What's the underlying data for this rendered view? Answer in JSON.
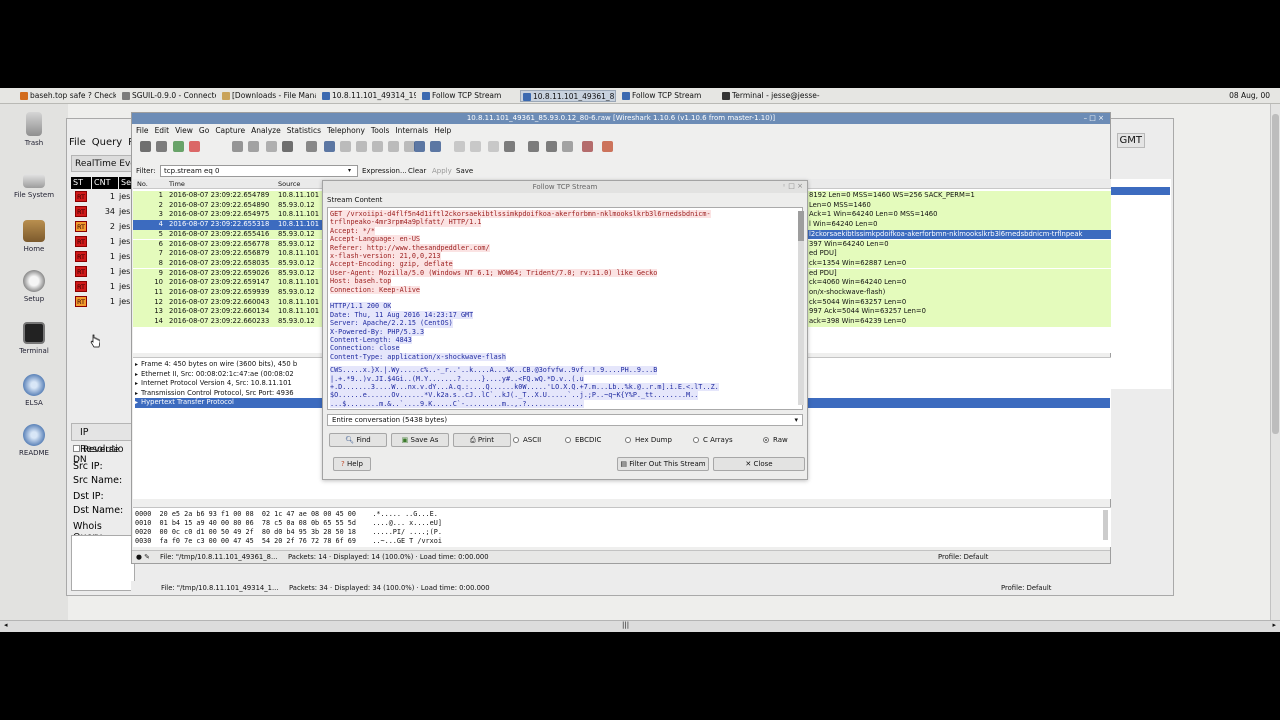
{
  "taskbar": {
    "tasks": [
      {
        "label": "baseh.top safe ? Check ..."
      },
      {
        "label": "SGUIL-0.9.0 - Connecte..."
      },
      {
        "label": "[Downloads - File Mana..."
      },
      {
        "label": "10.8.11.101_49314_198..."
      },
      {
        "label": "Follow TCP Stream"
      },
      {
        "label": "10.8.11.101_49361_85..."
      },
      {
        "label": "Follow TCP Stream"
      },
      {
        "label": "Terminal - jesse@jesse-..."
      }
    ],
    "clock": "08 Aug, 00"
  },
  "desktop": {
    "icons": [
      {
        "label": "Trash"
      },
      {
        "label": "File System"
      },
      {
        "label": "Home"
      },
      {
        "label": "Setup"
      },
      {
        "label": "Terminal"
      },
      {
        "label": "ELSA"
      },
      {
        "label": "README"
      }
    ]
  },
  "sguil": {
    "menu": [
      "File",
      "Query",
      "Re"
    ],
    "tab": "RealTime Eve",
    "gmt": "GMT",
    "headers": [
      "ST",
      "CNT",
      "Se"
    ],
    "rows": [
      {
        "st": "RT",
        "cnt": "1",
        "name": "jes"
      },
      {
        "st": "RT",
        "cnt": "34",
        "name": "jes"
      },
      {
        "st": "RT",
        "cnt": "2",
        "name": "jes"
      },
      {
        "st": "RT",
        "cnt": "1",
        "name": "jes"
      },
      {
        "st": "RT",
        "cnt": "1",
        "name": "jes"
      },
      {
        "st": "RT",
        "cnt": "1",
        "name": "jes"
      },
      {
        "st": "RT",
        "cnt": "1",
        "name": "jes"
      },
      {
        "st": "RT",
        "cnt": "1",
        "name": "jes"
      }
    ],
    "ip_panel": {
      "title": "IP Resolutio",
      "reverse": "Reverse DN",
      "src_ip": "Src IP:",
      "src_name": "Src Name:",
      "dst_ip": "Dst IP:",
      "dst_name": "Dst Name:",
      "whois": "Whois Query:"
    },
    "colors": {
      "rt_red": "#d01a1a",
      "rt_orange": "#f29a2e"
    }
  },
  "wireshark": {
    "title": "10.8.11.101_49361_85.93.0.12_80-6.raw  [Wireshark 1.10.6 (v1.10.6 from master-1.10)]",
    "menu": [
      "File",
      "Edit",
      "View",
      "Go",
      "Capture",
      "Analyze",
      "Statistics",
      "Telephony",
      "Tools",
      "Internals",
      "Help"
    ],
    "filter": {
      "label": "Filter:",
      "value": "tcp.stream eq 0",
      "expression": "Expression...",
      "clear": "Clear",
      "apply": "Apply",
      "save": "Save"
    },
    "columns": [
      "No.",
      "Time",
      "Source"
    ],
    "packets": [
      {
        "no": "1",
        "time": "2016-08-07 23:09:22.654789",
        "src": "10.8.11.101"
      },
      {
        "no": "2",
        "time": "2016-08-07 23:09:22.654890",
        "src": "85.93.0.12"
      },
      {
        "no": "3",
        "time": "2016-08-07 23:09:22.654975",
        "src": "10.8.11.101"
      },
      {
        "no": "4",
        "time": "2016-08-07 23:09:22.655318",
        "src": "10.8.11.101"
      },
      {
        "no": "5",
        "time": "2016-08-07 23:09:22.655416",
        "src": "85.93.0.12"
      },
      {
        "no": "6",
        "time": "2016-08-07 23:09:22.656778",
        "src": "85.93.0.12"
      },
      {
        "no": "7",
        "time": "2016-08-07 23:09:22.656879",
        "src": "10.8.11.101"
      },
      {
        "no": "8",
        "time": "2016-08-07 23:09:22.658035",
        "src": "85.93.0.12"
      },
      {
        "no": "9",
        "time": "2016-08-07 23:09:22.659026",
        "src": "85.93.0.12"
      },
      {
        "no": "10",
        "time": "2016-08-07 23:09:22.659147",
        "src": "10.8.11.101"
      },
      {
        "no": "11",
        "time": "2016-08-07 23:09:22.659939",
        "src": "85.93.0.12"
      },
      {
        "no": "12",
        "time": "2016-08-07 23:09:22.660043",
        "src": "10.8.11.101"
      },
      {
        "no": "13",
        "time": "2016-08-07 23:09:22.660134",
        "src": "10.8.11.101"
      },
      {
        "no": "14",
        "time": "2016-08-07 23:09:22.660233",
        "src": "85.93.0.12"
      }
    ],
    "info_tail": [
      "8192 Len=0 MSS=1460 WS=256 SACK_PERM=1",
      "Len=0 MSS=1460",
      "Ack=1 Win=64240 Len=0 MSS=1460",
      "l Win=64240 Len=0",
      "l2ckorsaekibtlssimkpdoifkoa-akerforbmn-nklmookslkrb3l6rnedsbdnicm-trflnpeak",
      "397 Win=64240 Len=0",
      "ed PDU]",
      "ck=1354 Win=62887 Len=0",
      "ed PDU]",
      "ck=4060 Win=64240 Len=0",
      "on/x-shockwave-flash)",
      "ck=5044 Win=63257 Len=0",
      "997 Ack=5044 Win=63257 Len=0",
      "ack=398 Win=64239 Len=0"
    ],
    "details": [
      "Frame 4: 450 bytes on wire (3600 bits), 450 b",
      "Ethernet II, Src: 00:08:02:1c:47:ae (00:08:02",
      "Internet Protocol Version 4, Src: 10.8.11.101",
      "Transmission Control Protocol, Src Port: 4936",
      "Hypertext Transfer Protocol"
    ],
    "hex": [
      "0000  20 e5 2a b6 93 f1 00 08  02 1c 47 ae 08 00 45 00    .*..... ..G...E.",
      "0010  01 b4 15 a9 40 00 80 06  78 c5 0a 08 0b 65 55 5d    ....@... x....eU]",
      "0020  00 0c c0 d1 00 50 49 2f  80 d0 b4 95 3b 28 50 18    .....PI/ ....;(P.",
      "0030  fa f0 7e c3 00 00 47 45  54 20 2f 76 72 78 6f 69    ..~...GE T /vrxoi"
    ],
    "status": {
      "file": "File: \"/tmp/10.8.11.101_49361_8...",
      "packets": "Packets: 14 · Displayed: 14 (100.0%) · Load time: 0:00.000",
      "profile": "Profile: Default"
    },
    "colors": {
      "row_green": "#e4fbbc",
      "selection": "#3c6bbf"
    }
  },
  "background_status": {
    "file": "File: \"/tmp/10.8.11.101_49314_1...",
    "packets": "Packets: 34 · Displayed: 34 (100.0%) · Load time: 0:00.000",
    "profile": "Profile: Default"
  },
  "follow_stream": {
    "title": "Follow TCP Stream",
    "legend": "Stream Content",
    "client_lines": [
      "GET /vrxoiipi-d4flf5n4d1iftl2ckorsaekibtlssimkpdoifkoa-akerforbmn-nklmookslkrb3l6rnedsbdnicm-",
      "trflnpeako-4mr3rpm4a9plfatt/ HTTP/1.1",
      "Accept: */*",
      "Accept-Language: en-US",
      "Referer: http://www.thesandpeddler.com/",
      "x-flash-version: 21,0,0,213",
      "Accept-Encoding: gzip, deflate",
      "User-Agent: Mozilla/5.0 (Windows NT 6.1; WOW64; Trident/7.0; rv:11.0) like Gecko",
      "Host: baseh.top",
      "Connection: Keep-Alive"
    ],
    "server_lines": [
      "HTTP/1.1 200 OK",
      "Date: Thu, 11 Aug 2016 14:23:17 GMT",
      "Server: Apache/2.2.15 (CentOS)",
      "X-Powered-By: PHP/5.3.3",
      "Content-Length: 4843",
      "Connection: close",
      "Content-Type: application/x-shockwave-flash"
    ],
    "binary_lines": [
      "CWS.....x.}X.|.Wy.....c%..-_r..'..k....A...%K..CB.@3ofvfw..9vf..!.9....PH..9...B",
      "|.+.*9..)v.JI.$4Gi..(M.Y.......?.....}....y#..<FQ.wQ.*D.v..(.u",
      "+.D.......3....W...nx.v.dY...A.q.:....Q......k0W.....'LO.X.Q.+7.m...Lb..%k.@..r.m].i.E.<.lT..Z.",
      "$O......e......Ov......*V.k2a.s..cJ..lC`..kJ(._T..X.U.....`..j.;P..~q~K{Y%P._tt........M..",
      "...$........m.&..`....9.K.....C`-.........m..,.?.............."
    ],
    "conversation": "Entire conversation (5438 bytes)",
    "buttons": {
      "find": "Find",
      "save_as": "Save As",
      "print": "Print",
      "help": "Help",
      "filter_out": "Filter Out This Stream",
      "close": "Close"
    },
    "formats": [
      "ASCII",
      "EBCDIC",
      "Hex Dump",
      "C Arrays",
      "Raw"
    ],
    "selected_format": "Raw",
    "colors": {
      "client_text": "#9b1d1d",
      "client_bg": "#fbe3e3",
      "server_text": "#1f2aa0",
      "server_bg": "#e5e6fb"
    }
  }
}
